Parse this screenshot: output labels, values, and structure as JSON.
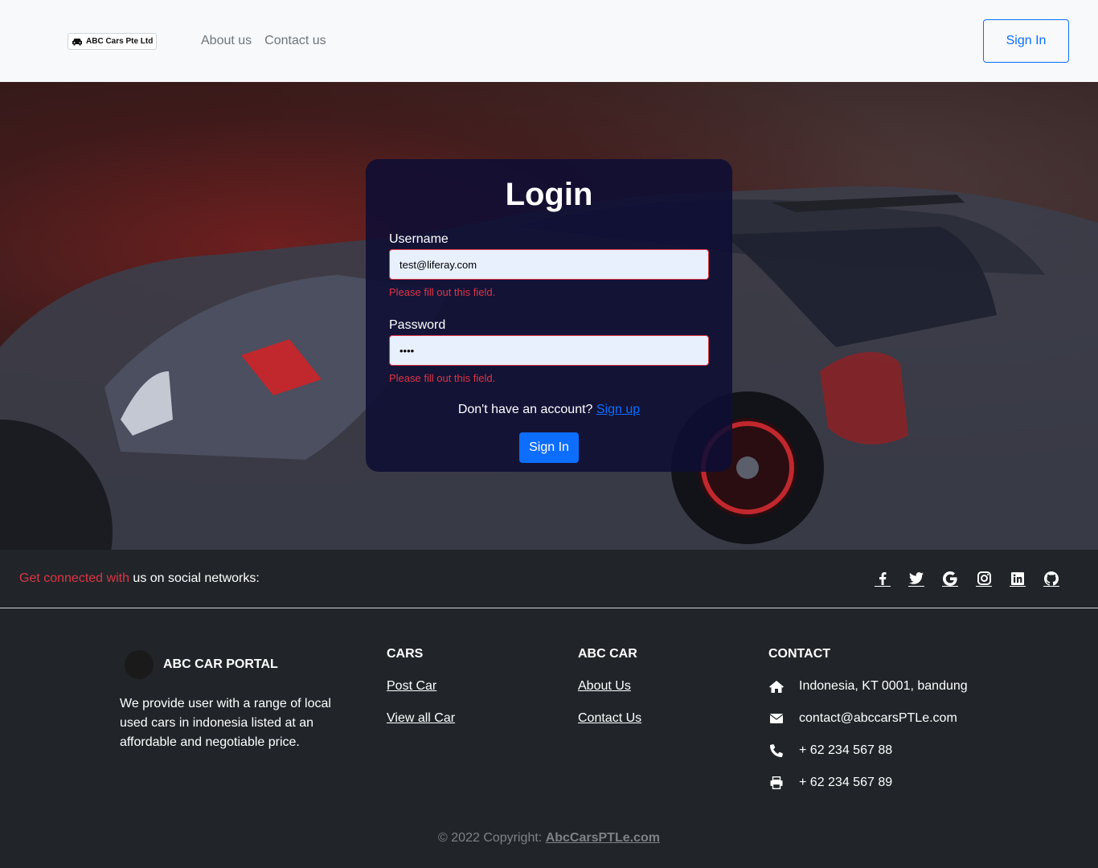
{
  "header": {
    "brand": "ABC Cars Pte Ltd",
    "nav": [
      "About us",
      "Contact us"
    ],
    "signin_label": "Sign In"
  },
  "login": {
    "title": "Login",
    "username_label": "Username",
    "username_value": "test@liferay.com",
    "username_error": "Please fill out this field.",
    "password_label": "Password",
    "password_value": "••••",
    "password_error": "Please fill out this field.",
    "signup_prompt": "Don't have an account?",
    "signup_link": "Sign up",
    "submit_label": "Sign In"
  },
  "social": {
    "text_highlight": "Get connected with",
    "text_rest": " us on social networks:",
    "icons": [
      "facebook-icon",
      "twitter-icon",
      "google-icon",
      "instagram-icon",
      "linkedin-icon",
      "github-icon"
    ]
  },
  "footer": {
    "portal_title": "ABC CAR PORTAL",
    "portal_description": "We provide user with a range of local used cars in indonesia listed at an affordable and negotiable price.",
    "cars_title": "CARS",
    "cars_links": [
      "Post Car",
      "View all Car"
    ],
    "abc_title": "ABC CAR",
    "abc_links": [
      "About Us",
      "Contact Us"
    ],
    "contact_title": "CONTACT",
    "contact": [
      {
        "icon": "home-icon",
        "text": "Indonesia, KT 0001, bandung"
      },
      {
        "icon": "envelope-icon",
        "text": "contact@abccarsPTLe.com"
      },
      {
        "icon": "phone-icon",
        "text": "+ 62 234 567 88"
      },
      {
        "icon": "print-icon",
        "text": "+ 62 234 567 89"
      }
    ],
    "copyright_prefix": "© 2022 Copyright: ",
    "copyright_link": "AbcCarsPTLe.com"
  },
  "colors": {
    "primary": "#0d6efd",
    "danger": "#dc3545",
    "footer_bg": "#212529",
    "navbar_bg": "#f8f9fa"
  }
}
